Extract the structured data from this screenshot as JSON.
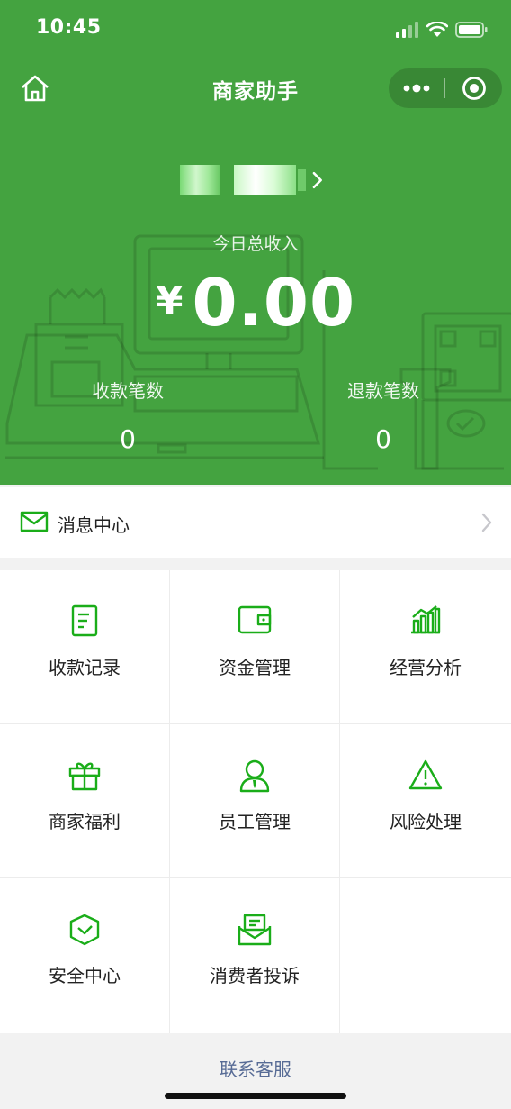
{
  "status_bar": {
    "time": "10:45"
  },
  "nav": {
    "title": "商家助手"
  },
  "header": {
    "income_label": "今日总收入",
    "currency": "¥",
    "income_amount": "0.00",
    "stats": [
      {
        "label": "收款笔数",
        "value": "0"
      },
      {
        "label": "退款笔数",
        "value": "0"
      }
    ]
  },
  "message_center": {
    "label": "消息中心"
  },
  "grid": [
    {
      "label": "收款记录",
      "icon": "receipt-icon"
    },
    {
      "label": "资金管理",
      "icon": "wallet-icon"
    },
    {
      "label": "经营分析",
      "icon": "bar-chart-icon"
    },
    {
      "label": "商家福利",
      "icon": "gift-icon"
    },
    {
      "label": "员工管理",
      "icon": "staff-icon"
    },
    {
      "label": "风险处理",
      "icon": "warning-icon"
    },
    {
      "label": "安全中心",
      "icon": "shield-icon"
    },
    {
      "label": "消费者投诉",
      "icon": "complaint-icon"
    }
  ],
  "footer": {
    "link": "联系客服"
  },
  "colors": {
    "brand_green": "#44a340",
    "icon_green": "#1aad19",
    "link_blue": "#576b95"
  }
}
